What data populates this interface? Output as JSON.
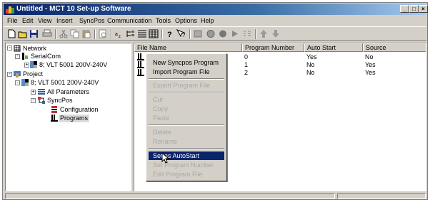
{
  "window": {
    "title": "Untitled - MCT 10 Set-up Software",
    "controls": [
      "_",
      "□",
      "×"
    ]
  },
  "menubar": {
    "items": [
      "File",
      "Edit",
      "View",
      "Insert",
      "SyncPos",
      "Communication",
      "Tools",
      "Options",
      "Help"
    ]
  },
  "toolbar": {
    "icons": [
      "new-icon",
      "open-icon",
      "save-icon",
      "print-icon",
      "cut-icon",
      "copy-icon",
      "paste-icon",
      "print-preview-icon",
      "sort-icon",
      "tree-icon",
      "details-icon",
      "grid-icon",
      "help-icon",
      "context-help-icon",
      "connect-icon",
      "disconnect-icon",
      "stop-icon",
      "run-icon",
      "scan-icon",
      "up-icon",
      "down-icon"
    ]
  },
  "tree": {
    "network": "Network",
    "serialcom": "SerialCom",
    "drive1": "8; VLT 5001 200V-240V",
    "project": "Project",
    "drive2": "8; VLT 5001 200V-240V",
    "all_params": "All Parameters",
    "syncpos": "SyncPos",
    "configuration": "Configuration",
    "programs": "Programs"
  },
  "list": {
    "columns": [
      "File Name",
      "Program Number",
      "Auto Start",
      "Source"
    ],
    "rows": [
      {
        "program_number": "0",
        "auto_start": "Yes",
        "source": "No"
      },
      {
        "program_number": "1",
        "auto_start": "No",
        "source": "Yes"
      },
      {
        "program_number": "2",
        "auto_start": "No",
        "source": "Yes"
      }
    ]
  },
  "context_menu": {
    "new_program": "New Syncpos Program",
    "import_program": "Import Program File",
    "export_program": "Export Program File",
    "cut": "Cut",
    "copy": "Copy",
    "paste": "Paste",
    "delete": "Delete",
    "rename": "Rename",
    "set_autostart": "Set as AutoStart",
    "set_program_number": "Set Program Number",
    "edit_program_file": "Edit Program File"
  }
}
